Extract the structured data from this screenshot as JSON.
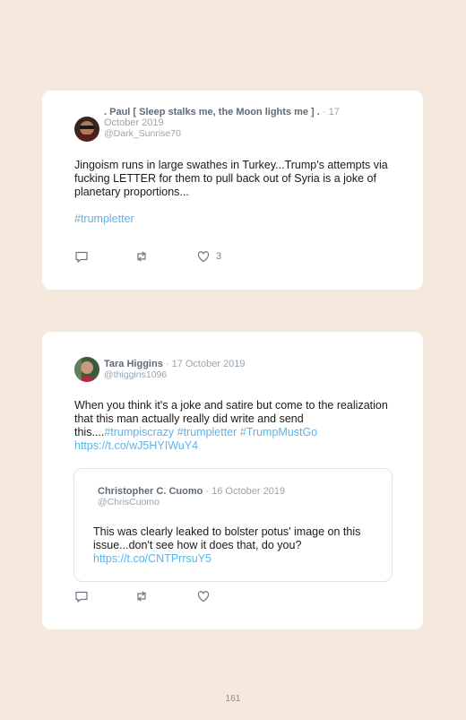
{
  "tweets": [
    {
      "author": ". Paul [ Sleep stalks me, the Moon lights me ] .",
      "date": " · 17 October 2019",
      "handle": "@Dark_Sunrise70",
      "text": "Jingoism runs in large swathes in Turkey...Trump's attempts via fucking LETTER for them to pull back out of Syria is a joke of planetary proportions...",
      "hashtag": "#trumpletter",
      "like_count": "3"
    },
    {
      "author": "Tara Higgins",
      "date": " · 17 October 2019",
      "handle": "@thiggins1096",
      "text": "When you think it's a joke and satire but come to the realization that this man actually really did write and send this....",
      "hashtags": [
        "#trumpiscrazy",
        "#trumpletter",
        "#TrumpMustGo"
      ],
      "link": "https://t.co/wJ5HYIWuY4",
      "quoted": {
        "author": "Christopher C. Cuomo",
        "date": " · 16 October 2019",
        "handle": "@ChrisCuomo",
        "text": "This was clearly leaked to bolster potus' image on this issue...don't see how it does that, do you?",
        "link": "https://t.co/CNTPrrsuY5"
      }
    }
  ],
  "icons": [
    "reply-icon",
    "retweet-icon",
    "like-icon"
  ],
  "colors": {
    "background": "#f5e8dd",
    "link": "#5bb4e8",
    "card": "#ffffff"
  },
  "page_number": "161"
}
